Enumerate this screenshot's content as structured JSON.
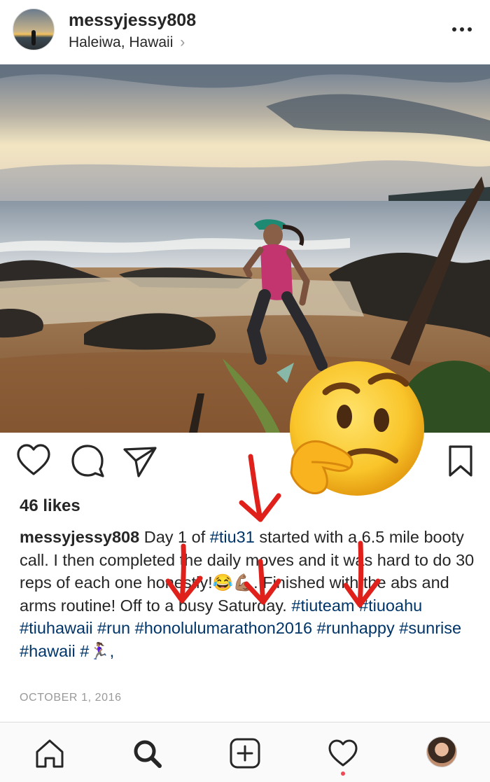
{
  "post": {
    "username": "messyjessy808",
    "location": "Haleiwa, Hawaii",
    "location_chevron": "›",
    "likes": "46 likes",
    "date": "OCTOBER 1, 2016",
    "caption": {
      "user": "messyjessy808",
      "text1": " Day 1 of ",
      "tag1": "#tiu31",
      "text2": " started with a 6.5 mile booty call. I then completed the daily moves and it was hard to do 30 reps of each one honestly!😂💪🏽. Finished with the abs and arms routine! Off to a busy Saturday. ",
      "tag2": "#tiuteam",
      "tag3": "#tiuoahu",
      "tag4": "#tiuhawaii",
      "tag5": "#run",
      "tag6": "#honolulumarathon2016",
      "tag7": "#runhappy",
      "tag8": "#sunrise",
      "tag9": "#hawaii",
      "tag10": "#🏃🏽‍♀️,"
    }
  },
  "icons": {
    "header": [
      "more-options-icon"
    ],
    "actions": [
      "heart-icon",
      "comment-icon",
      "share-icon",
      "bookmark-icon"
    ],
    "tabbar": [
      "home-icon",
      "search-icon",
      "add-post-icon",
      "activity-heart-icon",
      "profile-avatar"
    ],
    "overlay": [
      "thinking-face-emoji",
      "red-arrow"
    ]
  },
  "colors": {
    "text": "#262626",
    "hashtag": "#003569",
    "meta": "#999999",
    "annotation_arrow": "#e0211b",
    "notification_dot": "#ed4956"
  }
}
